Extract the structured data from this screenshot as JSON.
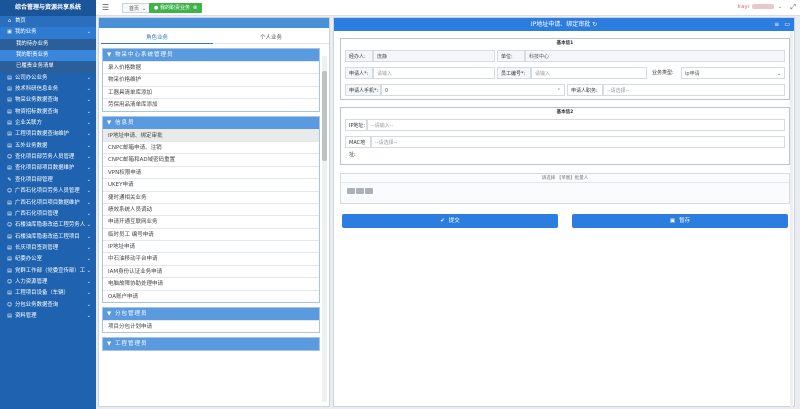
{
  "app": {
    "title": "综合管理与资源共享系统"
  },
  "sidebar": {
    "home": "首页",
    "my_business": "我的业务",
    "sub_items": [
      "我的待办业务",
      "我的职责业务",
      "已履责业务清单"
    ],
    "items": [
      "公司办公业务",
      "技术科研信息业务",
      "物采业务数据查询",
      "物资招标数据查询",
      "企业关联方",
      "工程项目数据查询维护",
      "五外业务数据",
      "查化项目部劳务人员管理",
      "查化项目部项目数据维护",
      "查化项目部管理",
      "广西石化项目劳务人员管理",
      "广西石化项目项目数据维护",
      "广西石化项目管理",
      "石楼油库隐患改造工程劳务人",
      "石楼油库隐患改造工程项目",
      "长庆项目签到管理",
      "纪委办公室",
      "党群工作部（党委宣传部）工",
      "人力资源管理",
      "工程项目设备（车辆）",
      "分包业务数据查询",
      "资料管理"
    ]
  },
  "topbar": {
    "home_tab": "首页",
    "active_tab": "我的职责业务",
    "user": "kayi"
  },
  "left": {
    "tabs": [
      "角色业务",
      "个人业务"
    ],
    "groups": [
      {
        "title": "物采中心系统管理员",
        "items": [
          "录入价格数据",
          "物采价格维护",
          "工器具清单库添加",
          "劳保用品清单库添加"
        ]
      },
      {
        "title": "信息员",
        "items": [
          "IP地址申请、绑定审批",
          "CNPC邮箱申请、注销",
          "CNPC邮箱和AD域密码重置",
          "VPN权限申请",
          "UKEY申请",
          "捷时通相关业务",
          "绩效系统人员调动",
          "申请开通互联网业务",
          "临时员工 编号申请",
          "IP地址申请",
          "中石油移动平台申请",
          "IAM身份认证业务申请",
          "电脑故障协助处理申请",
          "OA账户申请"
        ]
      },
      {
        "title": "分包管理员",
        "items": [
          "项目分包计划申请"
        ]
      },
      {
        "title": "工程管理员",
        "items": []
      }
    ]
  },
  "form": {
    "title": "IP地址申请、绑定审批",
    "section1_title": "基本信1",
    "section2_title": "基本信2",
    "handler_label": "经办人:",
    "handler_value": "庞静",
    "unit_label": "单位:",
    "unit_value": "科技中心",
    "applicant_label": "申请人*:",
    "applicant_placeholder": "请输入",
    "staff_no_label": "员工编号*:",
    "staff_no_placeholder": "请输入",
    "biz_type_label": "业务类型:",
    "biz_type_value": "ip申请",
    "phone_label": "申请人手机*:",
    "phone_value": "0",
    "position_label": "申请人职务:",
    "position_placeholder": "--请选择--",
    "ip_label": "IP地址:",
    "ip_placeholder": "--请输入--",
    "mac_label": "MAC地址:",
    "mac_placeholder": "--请选择--",
    "attach_text": "请选择 【单图】批量人",
    "submit_label": "提交",
    "save_label": "暂存"
  }
}
